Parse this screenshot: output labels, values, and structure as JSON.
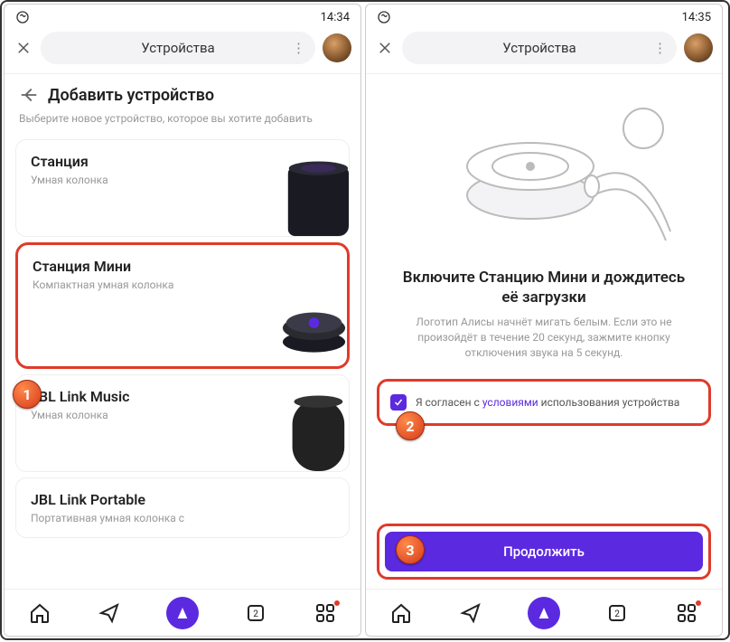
{
  "status": {
    "time": "14:34",
    "time2": "14:35"
  },
  "header": {
    "title": "Устройства",
    "menu": "⋮"
  },
  "left": {
    "page_title": "Добавить устройство",
    "hint": "Выберите новое устройство, которое вы хотите добавить",
    "items": [
      {
        "title": "Станция",
        "desc": "Умная колонка"
      },
      {
        "title": "Станция Мини",
        "desc": "Компактная умная колонка"
      },
      {
        "title": "JBL Link Music",
        "desc": "Умная колонка"
      },
      {
        "title": "JBL Link Portable",
        "desc": "Портативная умная колонка с"
      }
    ]
  },
  "right": {
    "title": "Включите Станцию Мини и дождитесь\nеё загрузки",
    "body": "Логотип Алисы начнёт мигать белым. Если это не произойдёт в течение 20 секунд, зажмите кнопку отключения звука на 5 секунд.",
    "consent_pre": "Я согласен с ",
    "consent_link": "условиями",
    "consent_post": " использования устройства",
    "cta": "Продолжить"
  },
  "steps": {
    "s1": "1",
    "s2": "2",
    "s3": "3"
  }
}
